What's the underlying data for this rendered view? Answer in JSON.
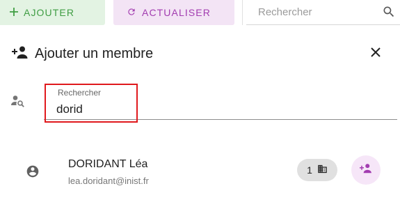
{
  "toolbar": {
    "add_label": "AJOUTER",
    "refresh_label": "ACTUALISER",
    "search_placeholder": "Rechercher"
  },
  "dialog": {
    "title": "Ajouter un membre",
    "search_field": {
      "label": "Rechercher",
      "value": "dorid"
    }
  },
  "results": [
    {
      "name": "DORIDANT Léa",
      "email": "lea.doridant@inist.fr",
      "chip_count": "1",
      "chip_icon": "building-icon",
      "action_icon": "person-add-icon"
    }
  ],
  "colors": {
    "add_bg": "#e3f3e3",
    "add_text": "#3f9d43",
    "refresh_bg": "#f3e4f5",
    "refresh_text": "#a23cb0",
    "highlight": "#e0191d",
    "accent": "#a23cb0"
  }
}
